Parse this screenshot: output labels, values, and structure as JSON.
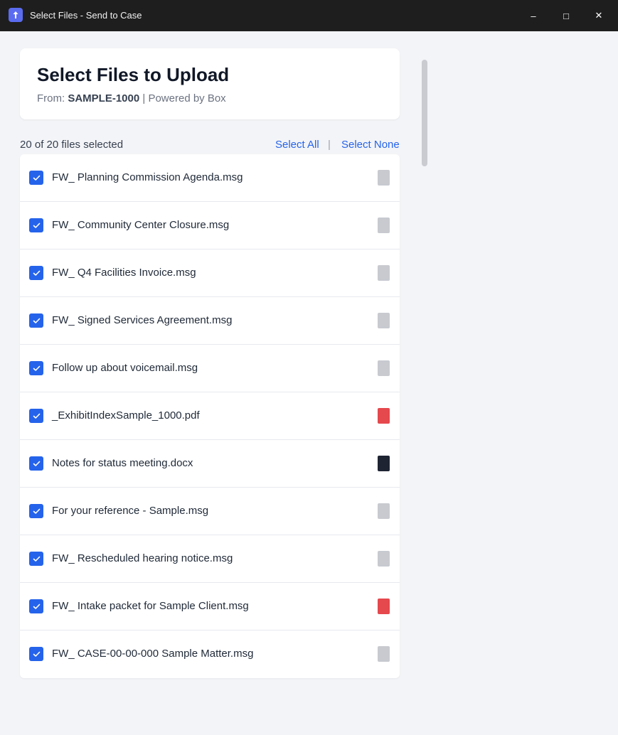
{
  "window": {
    "title": "Select Files - Send to Case",
    "minimize_glyph": "–",
    "maximize_glyph": "□",
    "close_glyph": "✕",
    "icon": "upload-arrow-icon",
    "icon_color": "#5b6cf0"
  },
  "header": {
    "title": "Select Files to Upload",
    "from_label": "From:",
    "case_id": "SAMPLE-1000",
    "powered_by": "| Powered by Box"
  },
  "toolbar": {
    "count_text": "20 of 20 files selected",
    "select_all": "Select All",
    "separator": "|",
    "select_none": "Select None"
  },
  "files": [
    {
      "name": "FW_ Planning Commission Agenda.msg",
      "checked": true,
      "type_color": "#c8cad0"
    },
    {
      "name": "FW_ Community Center Closure.msg",
      "checked": true,
      "type_color": "#c8cad0"
    },
    {
      "name": "FW_ Q4 Facilities Invoice.msg",
      "checked": true,
      "type_color": "#c8cad0"
    },
    {
      "name": "FW_ Signed Services Agreement.msg",
      "checked": true,
      "type_color": "#c8cad0"
    },
    {
      "name": "Follow up about voicemail.msg",
      "checked": true,
      "type_color": "#c8cad0"
    },
    {
      "name": "_ExhibitIndexSample_1000.pdf",
      "checked": true,
      "type_color": "#e5484d"
    },
    {
      "name": "Notes for status meeting.docx",
      "checked": true,
      "type_color": "#1f2433"
    },
    {
      "name": "For your reference - Sample.msg",
      "checked": true,
      "type_color": "#c8cad0"
    },
    {
      "name": "FW_ Rescheduled hearing notice.msg",
      "checked": true,
      "type_color": "#c8cad0"
    },
    {
      "name": "FW_ Intake packet for Sample Client.msg",
      "checked": true,
      "type_color": "#e5484d"
    },
    {
      "name": "FW_ CASE-00-00-000 Sample Matter.msg",
      "checked": true,
      "type_color": "#c8cad0"
    }
  ],
  "colors": {
    "accent": "#2563eb",
    "titlebar": "#1e1e1e",
    "background": "#f3f4f7"
  }
}
